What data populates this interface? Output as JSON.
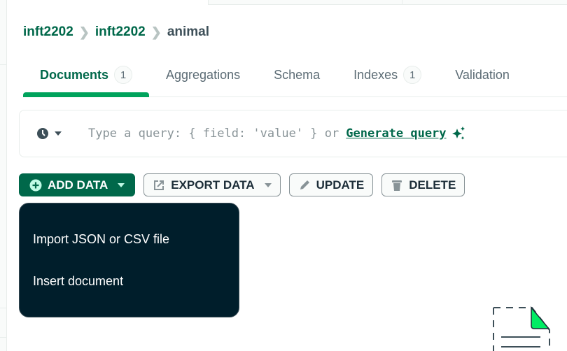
{
  "breadcrumb": [
    "inft2202",
    "inft2202",
    "animal"
  ],
  "tabs": [
    {
      "label": "Documents",
      "badge": "1",
      "active": true
    },
    {
      "label": "Aggregations"
    },
    {
      "label": "Schema"
    },
    {
      "label": "Indexes",
      "badge": "1"
    },
    {
      "label": "Validation"
    }
  ],
  "query": {
    "placeholder": "Type a query: { field: 'value' } or",
    "generate_link": "Generate query",
    "history_icon": "clock-icon"
  },
  "toolbar": {
    "add_data": "ADD DATA",
    "export_data": "EXPORT DATA",
    "update": "UPDATE",
    "delete": "DELETE"
  },
  "add_data_menu": [
    "Import JSON or CSV file",
    "Insert document"
  ],
  "colors": {
    "brand": "#00684a",
    "accent": "#00a35c",
    "menu_bg": "#001e2b"
  }
}
